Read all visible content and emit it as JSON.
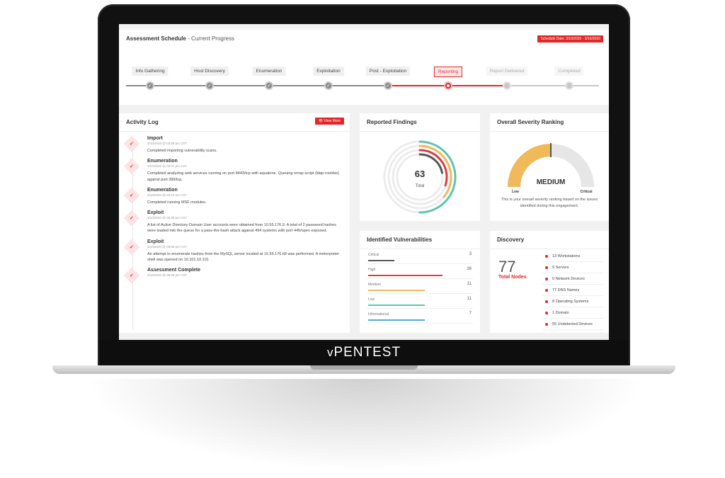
{
  "brand": {
    "prefix": "v",
    "name": "PENTEST"
  },
  "schedule": {
    "title": "Assessment Schedule",
    "subtitle": " - Current Progress",
    "date_badge": "Schedule Date: 3/10/2020 - 3/16/2020",
    "steps": [
      {
        "label": "Info Gathering",
        "state": "done"
      },
      {
        "label": "Host Discovery",
        "state": "done"
      },
      {
        "label": "Enumeration",
        "state": "done"
      },
      {
        "label": "Exploitation",
        "state": "done"
      },
      {
        "label": "Post - Exploitation",
        "state": "done"
      },
      {
        "label": "Reporting",
        "state": "active"
      },
      {
        "label": "Report Delivered",
        "state": "future"
      },
      {
        "label": "Completed",
        "state": "future"
      }
    ]
  },
  "activity": {
    "title": "Activity Log",
    "view_more": "View More",
    "items": [
      {
        "title": "Import",
        "time": "3/10/2020 @ 03:59 pm CST",
        "desc": "Completed importing vulnerability scans."
      },
      {
        "title": "Enumeration",
        "time": "3/10/2020 @ 03:31 pm CST",
        "desc": "Completed analyzing web services running on port 8443/tcp with aquatone. Queuing nmap script (ldap-rootdse) against port 389/tcp."
      },
      {
        "title": "Enumeration",
        "time": "3/10/2020 @ 03:10 pm CST",
        "desc": "Completed running MSF modules."
      },
      {
        "title": "Exploit",
        "time": "3/10/2020 @ 05:08 pm CST",
        "desc": "A list of Active Directory Domain User accounts were obtained from 10.55.176.9. A total of 2 password hashes were loaded into the queue for a pass-the-hash attack against 494 systems with port 445/open exposed."
      },
      {
        "title": "Exploit",
        "time": "3/10/2020 @ 05:08 pm CST",
        "desc": "An attempt to enumerate hashes from the MySQL server located at 10.55.176.68 was performed. A meterpreter shell was opened on 10.101.10.101"
      },
      {
        "title": "Assessment Complete",
        "time": "3/10/2020 @ 05:08 pm CST",
        "desc": ""
      }
    ]
  },
  "findings": {
    "title": "Reported Findings",
    "total": "63",
    "total_label": "Total",
    "colors": [
      "#5fc4b0",
      "#f0b95a",
      "#e03a3a",
      "#555555"
    ]
  },
  "severity": {
    "title": "Overall Severity Ranking",
    "value": "MEDIUM",
    "low_label": "Low",
    "critical_label": "Critical",
    "level": 0.5,
    "caption": "This is your overall severity ranking based on the issues identified during this engagement.",
    "color": "#f0b95a"
  },
  "vulnerabilities": {
    "title": "Identified Vulnerabilities",
    "rows": [
      {
        "name": "Critical",
        "count": "3",
        "fraction": 0.25,
        "color": "#555555"
      },
      {
        "name": "High",
        "count": "26",
        "fraction": 0.72,
        "color": "#e03a3a"
      },
      {
        "name": "Medium",
        "count": "11",
        "fraction": 0.55,
        "color": "#f0b95a"
      },
      {
        "name": "Low",
        "count": "11",
        "fraction": 0.55,
        "color": "#5fc4b0"
      },
      {
        "name": "Informational",
        "count": "7",
        "fraction": 0.55,
        "color": "#5aa6d9"
      }
    ]
  },
  "discovery": {
    "title": "Discovery",
    "total": "77",
    "total_label": "Total Nodes",
    "items": [
      "13 Workstations",
      "9 Servers",
      "0 Network Devices",
      "77 DNS Names",
      "8 Operating Systems",
      "1 Domain",
      "55 Undetected Devices"
    ]
  }
}
